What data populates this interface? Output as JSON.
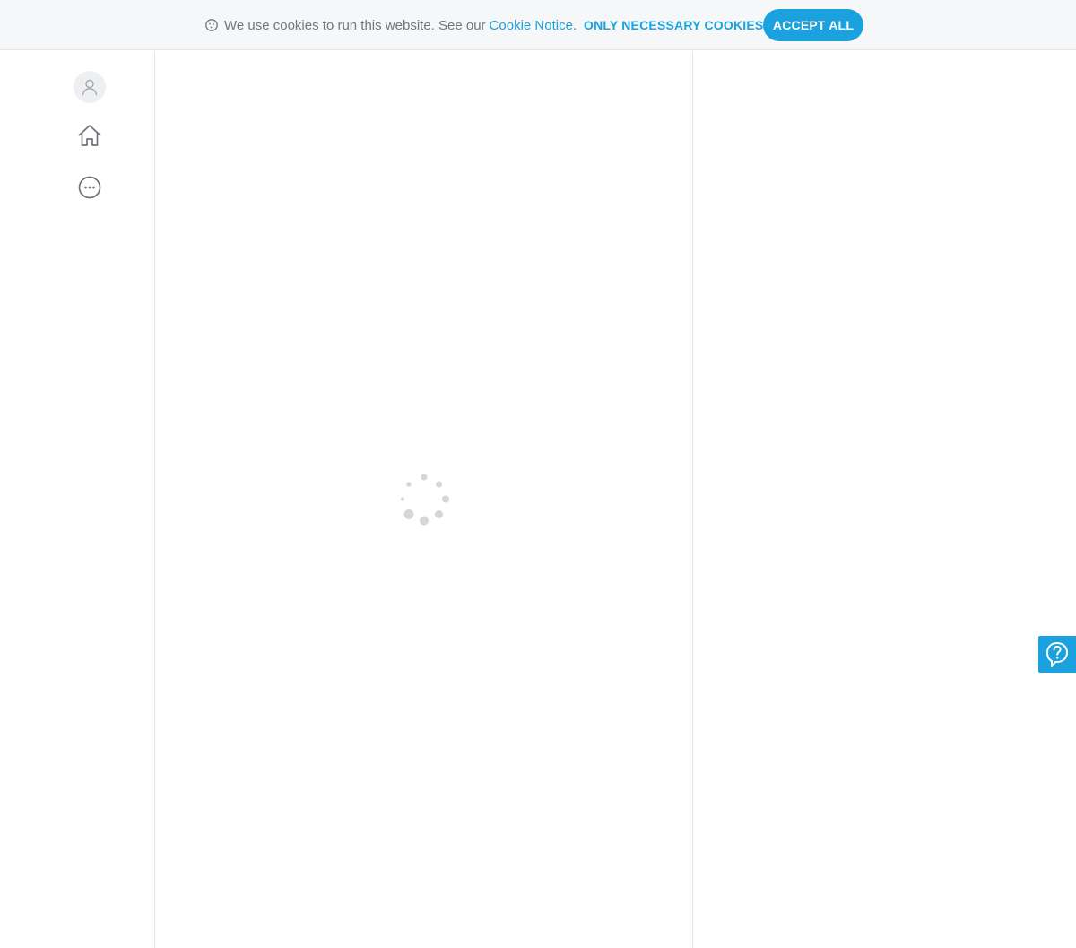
{
  "cookie_banner": {
    "message": "We use cookies to run this website. See our",
    "link_label": "Cookie Notice",
    "punctuation": ".",
    "necessary_label": "ONLY NECESSARY COOKIES",
    "accept_label": "ACCEPT ALL",
    "icon": "cookie-icon"
  },
  "sidebar": {
    "items": [
      {
        "icon": "user-icon"
      },
      {
        "icon": "home-icon"
      },
      {
        "icon": "more-icon"
      }
    ]
  },
  "main": {
    "state": "loading",
    "indicator": "spinner"
  },
  "help": {
    "icon": "question-icon"
  },
  "colors": {
    "accent": "#1ba1dd",
    "text_muted": "#72767b",
    "banner_bg": "#f6f7f8",
    "border": "#e3e5e8",
    "spinner": "#d4d6d9"
  }
}
